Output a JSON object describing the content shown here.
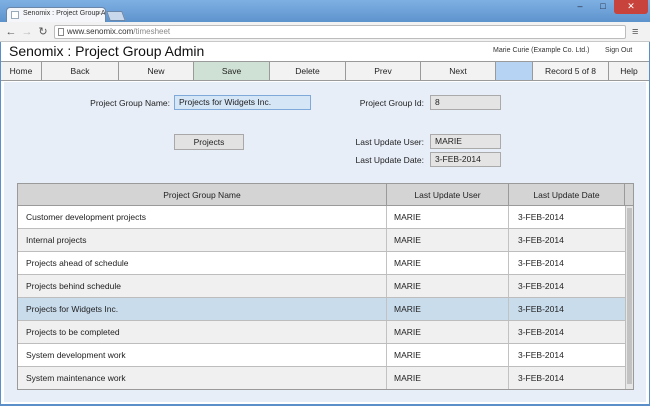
{
  "browser": {
    "tab_title": "Senomix : Project Group A",
    "tab_close": "×",
    "url_host": "www.senomix.com",
    "url_path": "/timesheet",
    "window_min": "–",
    "window_max": "□",
    "window_close": "✕",
    "back_glyph": "←",
    "forward_glyph": "→",
    "reload_glyph": "↻",
    "menu_glyph": "≡"
  },
  "header": {
    "title": "Senomix : Project Group Admin",
    "user": "Marie Curie  (Example Co. Ltd.)",
    "sign_out": "Sign Out"
  },
  "buttons": {
    "home": "Home",
    "back": "Back",
    "new": "New",
    "save": "Save",
    "delete": "Delete",
    "prev": "Prev",
    "next": "Next",
    "blank": "",
    "record": "Record 5 of 8",
    "help": "Help"
  },
  "form": {
    "group_name_label": "Project Group Name:",
    "group_name_value": "Projects for Widgets Inc.",
    "group_id_label": "Project Group Id:",
    "group_id_value": "8",
    "projects_button": "Projects",
    "last_user_label": "Last Update User:",
    "last_user_value": "MARIE",
    "last_date_label": "Last Update Date:",
    "last_date_value": "3-FEB-2014"
  },
  "table": {
    "headers": [
      "Project Group Name",
      "Last Update User",
      "Last Update Date"
    ],
    "rows": [
      {
        "name": "Customer development projects",
        "user": "MARIE",
        "date": "3-FEB-2014"
      },
      {
        "name": "Internal projects",
        "user": "MARIE",
        "date": "3-FEB-2014"
      },
      {
        "name": "Projects ahead of schedule",
        "user": "MARIE",
        "date": "3-FEB-2014"
      },
      {
        "name": "Projects behind schedule",
        "user": "MARIE",
        "date": "3-FEB-2014"
      },
      {
        "name": "Projects for Widgets Inc.",
        "user": "MARIE",
        "date": "3-FEB-2014"
      },
      {
        "name": "Projects to be completed",
        "user": "MARIE",
        "date": "3-FEB-2014"
      },
      {
        "name": "System development work",
        "user": "MARIE",
        "date": "3-FEB-2014"
      },
      {
        "name": "System maintenance work",
        "user": "MARIE",
        "date": "3-FEB-2014"
      }
    ],
    "selected_index": 4
  },
  "colors": {
    "accent": "#b7d3f4",
    "save_bg": "#cfe0d4",
    "selected_row": "#c9dcec",
    "panel_bg": "#e7eef8"
  }
}
